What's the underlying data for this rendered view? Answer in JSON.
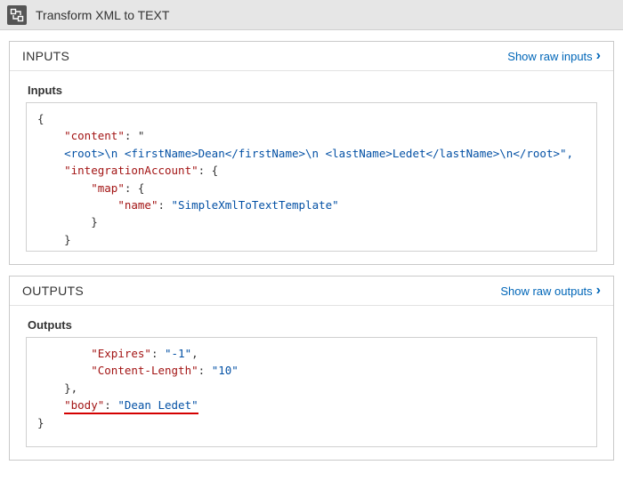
{
  "title": "Transform XML to TEXT",
  "inputs": {
    "header": "INPUTS",
    "show_raw_label": "Show raw inputs",
    "subhead": "Inputs",
    "code": {
      "key_content": "\"content\"",
      "content_open": ": \"",
      "content_value": "<root>\\n <firstName>Dean</firstName>\\n <lastName>Ledet</lastName>\\n</root>\",",
      "key_integrationAccount": "\"integrationAccount\"",
      "key_map": "\"map\"",
      "key_name": "\"name\"",
      "name_value": "\"SimpleXmlToTextTemplate\""
    }
  },
  "outputs": {
    "header": "OUTPUTS",
    "show_raw_label": "Show raw outputs",
    "subhead": "Outputs",
    "code": {
      "key_expires": "\"Expires\"",
      "expires_value": "\"-1\"",
      "key_contentLength": "\"Content-Length\"",
      "contentLength_value": "\"10\"",
      "key_body": "\"body\"",
      "body_value": "\"Dean Ledet\""
    }
  }
}
